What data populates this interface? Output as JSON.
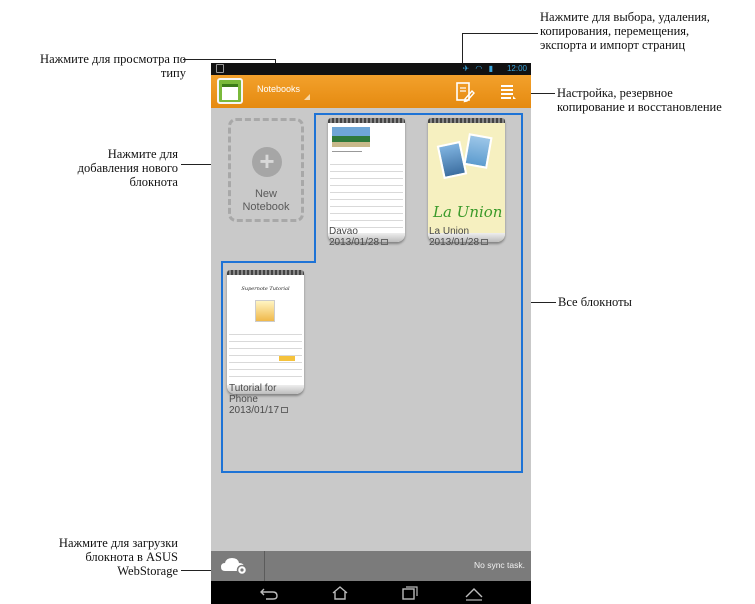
{
  "callouts": {
    "view_type": "Нажмите для просмотра по\nтипу",
    "add_notebook": "Нажмите для\nдобавления нового\nблокнота",
    "upload": "Нажмите для загрузки\nблокнота в ASUS\nWebStorage",
    "select_actions": "Нажмите для выбора, удаления,\nкопирования, перемещения,\nэкспорта и импорт страниц",
    "settings": "Настройка, резервное\nкопирование и восстановление",
    "all_notebooks": "Все блокноты"
  },
  "statusbar": {
    "time": "12:00"
  },
  "actionbar": {
    "view_dropdown": "Notebooks"
  },
  "new_notebook": {
    "label": "New\nNotebook"
  },
  "notebooks": [
    {
      "title": "Davao",
      "date": "2013/01/28"
    },
    {
      "title": "La Union",
      "date": "2013/01/28"
    },
    {
      "title": "Tutorial for\nPhone",
      "date": "2013/01/17"
    }
  ],
  "cover_text": {
    "la_union": "La Union",
    "tutorial_title": "Supernote Tutorial"
  },
  "syncbar": {
    "status": "No sync task."
  },
  "colors": {
    "accent": "#1e73d6",
    "actionbar": "#e8921a"
  }
}
